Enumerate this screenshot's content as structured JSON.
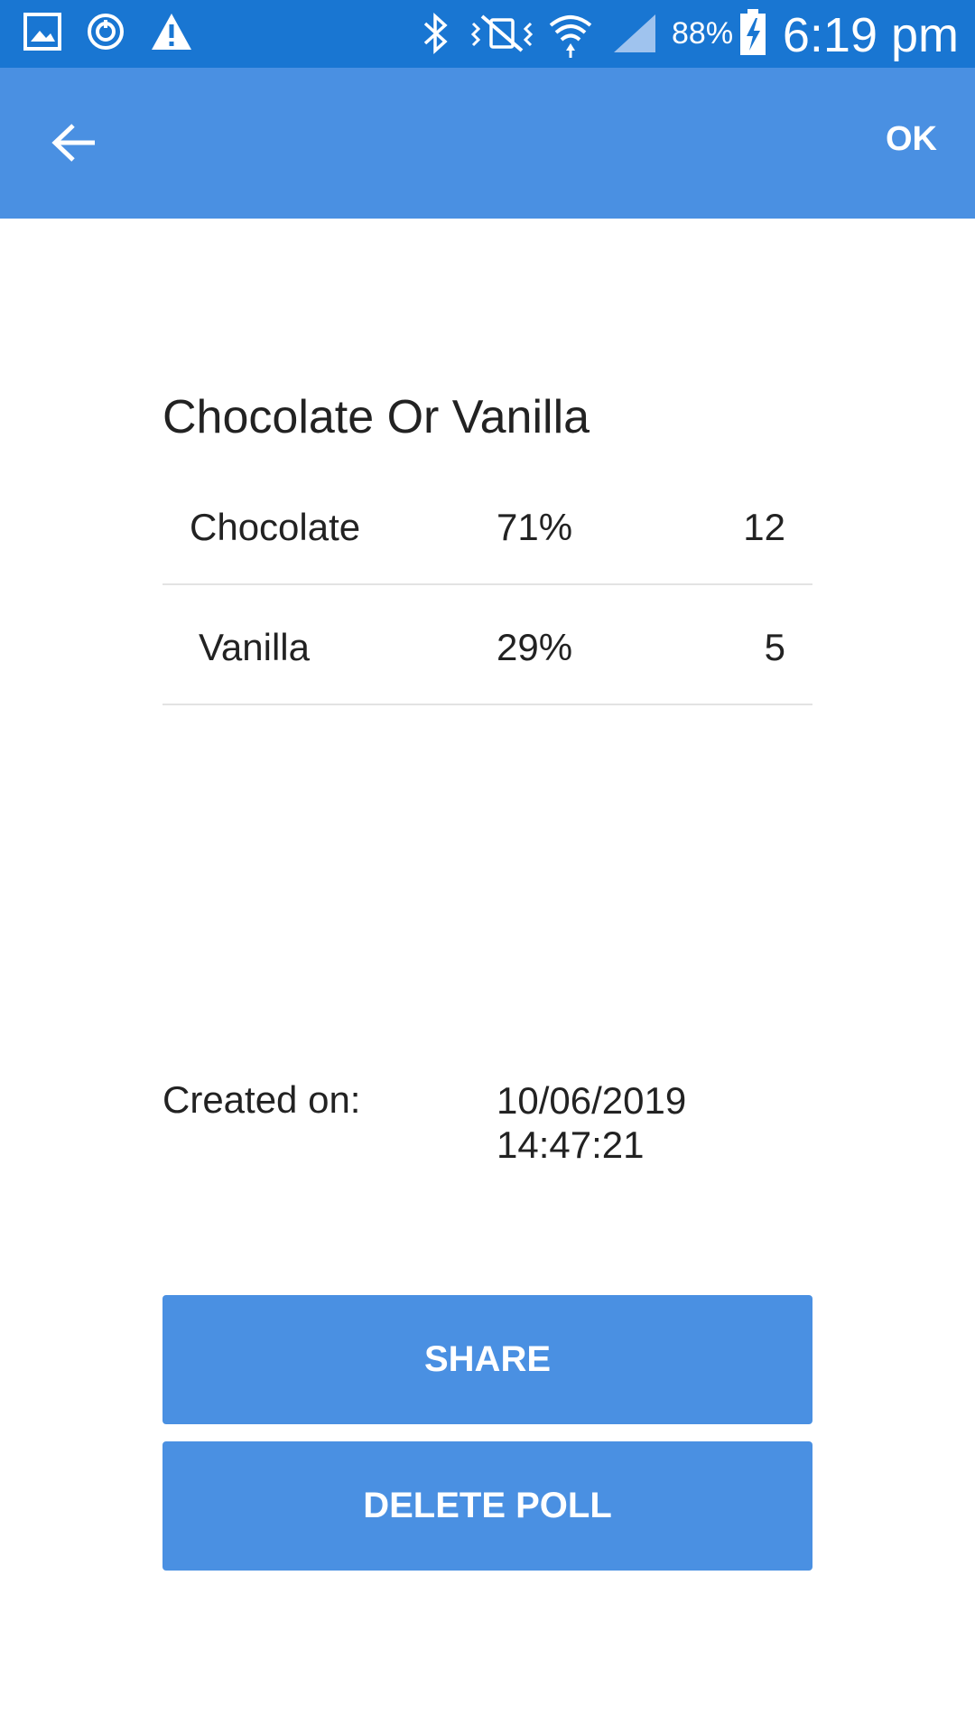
{
  "status_bar": {
    "battery": "88%",
    "time": "6:19 pm"
  },
  "app_bar": {
    "back_icon": "arrow-left-icon",
    "ok_label": "OK"
  },
  "poll": {
    "title": "Chocolate Or Vanilla",
    "options": [
      {
        "label": "Chocolate",
        "percent": "71%",
        "count": "12"
      },
      {
        "label": "Vanilla",
        "percent": "29%",
        "count": "5"
      }
    ]
  },
  "created": {
    "label": "Created on:",
    "date": "10/06/2019",
    "time": "14:47:21"
  },
  "buttons": {
    "share": "SHARE",
    "delete": "DELETE POLL"
  },
  "colors": {
    "status_bar": "#1976d2",
    "app_bar": "#4a90e2",
    "button": "#4a90e2"
  }
}
